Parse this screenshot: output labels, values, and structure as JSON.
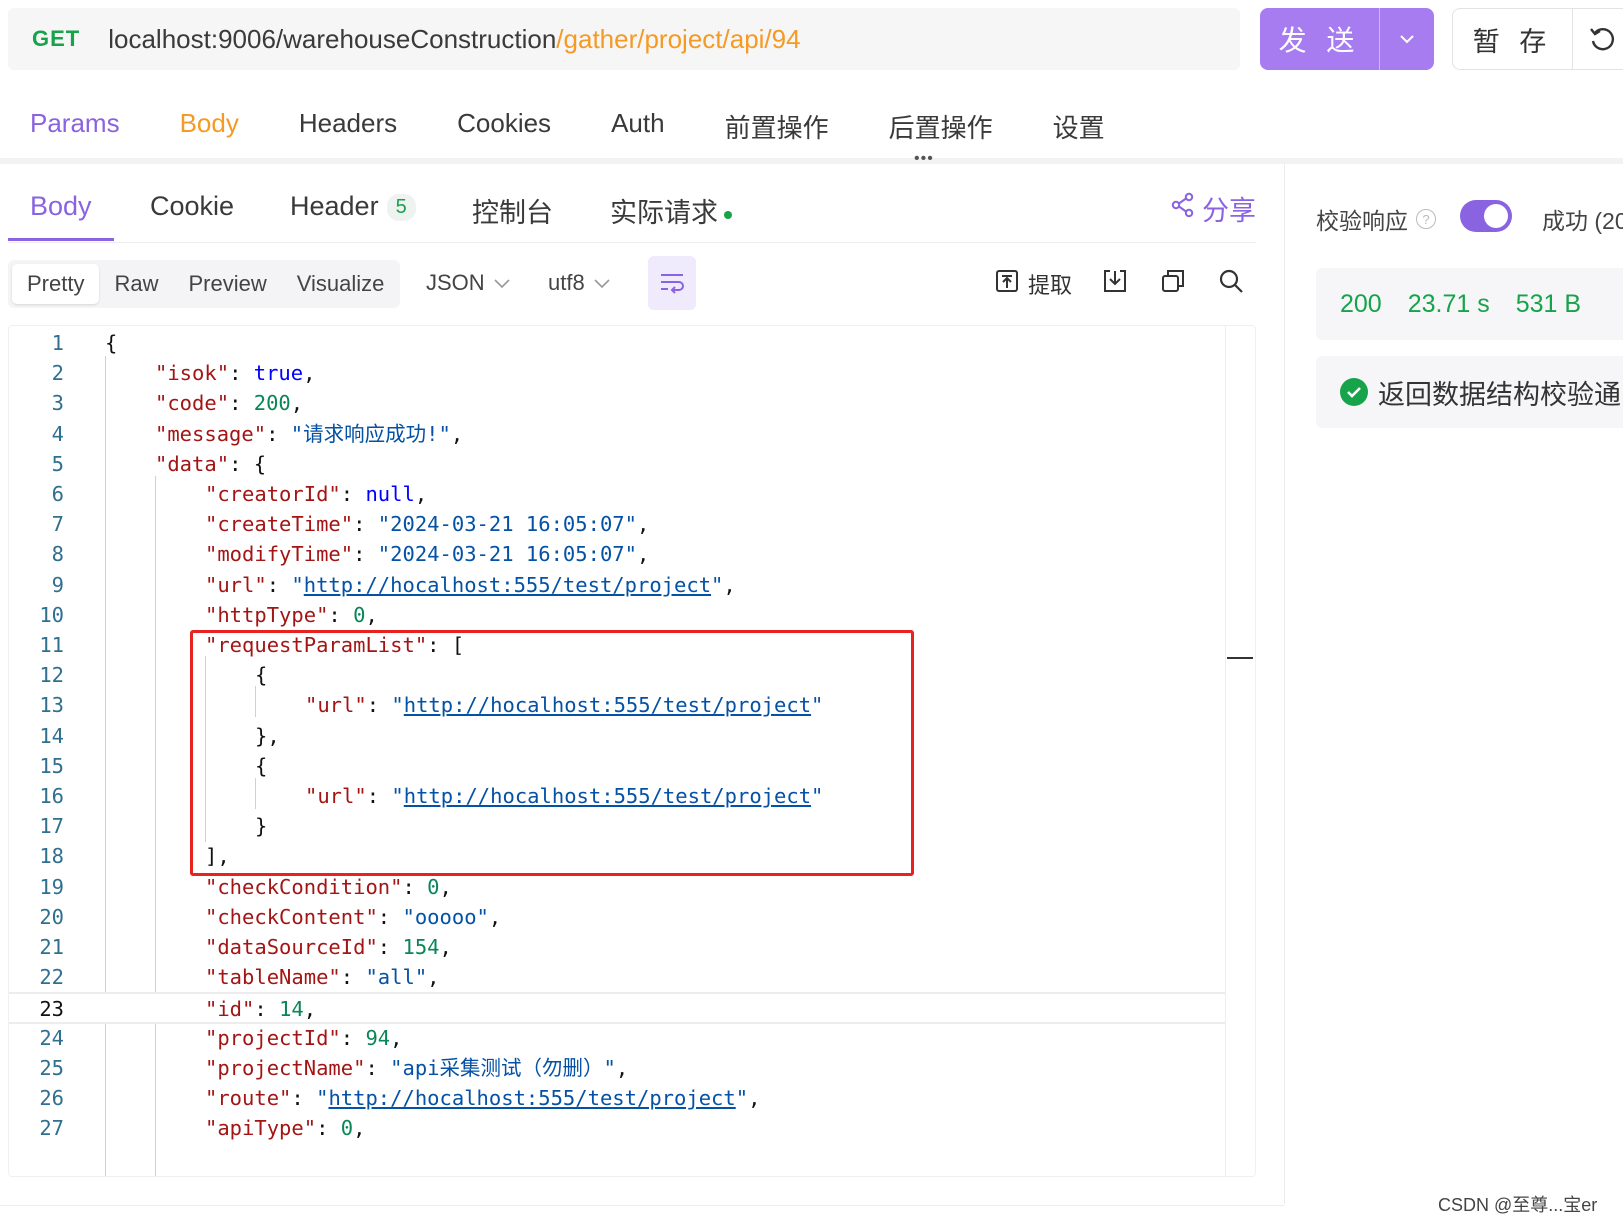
{
  "request": {
    "method": "GET",
    "url_base": "localhost:9006/warehouseConstruction",
    "url_path": "/gather/project/api/94",
    "send_label": "发 送",
    "save_label": "暂 存"
  },
  "request_tabs": [
    "Params",
    "Body",
    "Headers",
    "Cookies",
    "Auth",
    "前置操作",
    "后置操作",
    "设置"
  ],
  "response_tabs": {
    "body": "Body",
    "cookie": "Cookie",
    "header": "Header",
    "header_count": "5",
    "console": "控制台",
    "actual_request": "实际请求",
    "share": "分享"
  },
  "format": {
    "modes": [
      "Pretty",
      "Raw",
      "Preview",
      "Visualize"
    ],
    "type": "JSON",
    "encoding": "utf8",
    "extract_label": "提取"
  },
  "code_lines": [
    "{",
    "\"isok\": true,",
    "\"code\": 200,",
    "\"message\": \"请求响应成功!\",",
    "\"data\": {",
    "\"creatorId\": null,",
    "\"createTime\": \"2024-03-21 16:05:07\",",
    "\"modifyTime\": \"2024-03-21 16:05:07\",",
    "\"url\": \"http://hocalhost:555/test/project\",",
    "\"httpType\": 0,",
    "\"requestParamList\": [",
    "{",
    "\"url\": \"http://hocalhost:555/test/project\"",
    "},",
    "{",
    "\"url\": \"http://hocalhost:555/test/project\"",
    "}",
    "],",
    "\"checkCondition\": 0,",
    "\"checkContent\": \"ooooo\",",
    "\"dataSourceId\": 154,",
    "\"tableName\": \"all\",",
    "\"id\": 14,",
    "\"projectId\": 94,",
    "\"projectName\": \"api采集测试（勿删）\",",
    "\"route\": \"http://hocalhost:555/test/project\",",
    "\"apiType\": 0,"
  ],
  "response_panel": {
    "validate_label": "校验响应",
    "validate_enabled": true,
    "result_label": "成功 (20",
    "status": "200",
    "time": "23.71 s",
    "size": "531 B",
    "validation_message": "返回数据结构校验通"
  },
  "watermark": "CSDN @至尊...宝er",
  "colors": {
    "accent": "#8a63e0",
    "success": "#17a34a",
    "orange": "#f59a23",
    "highlight_box": "#e8231f"
  }
}
